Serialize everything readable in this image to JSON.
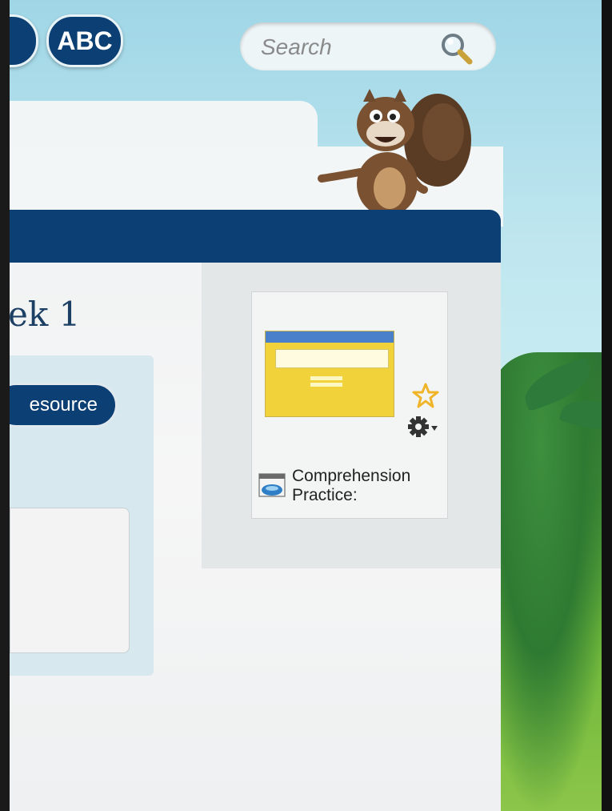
{
  "header": {
    "abc_label": "ABC",
    "search": {
      "placeholder": "Search"
    }
  },
  "main": {
    "week_title": "ek 1",
    "resource_button": "esource"
  },
  "card": {
    "title": "Comprehension Practice:"
  },
  "colors": {
    "navy": "#0c3f73",
    "star": "#f0b429",
    "thumb_yellow": "#f1d23a"
  },
  "icons": [
    "search-icon",
    "star-icon",
    "gear-icon",
    "chevron-down-icon",
    "activity-type-icon",
    "squirrel-mascot"
  ]
}
